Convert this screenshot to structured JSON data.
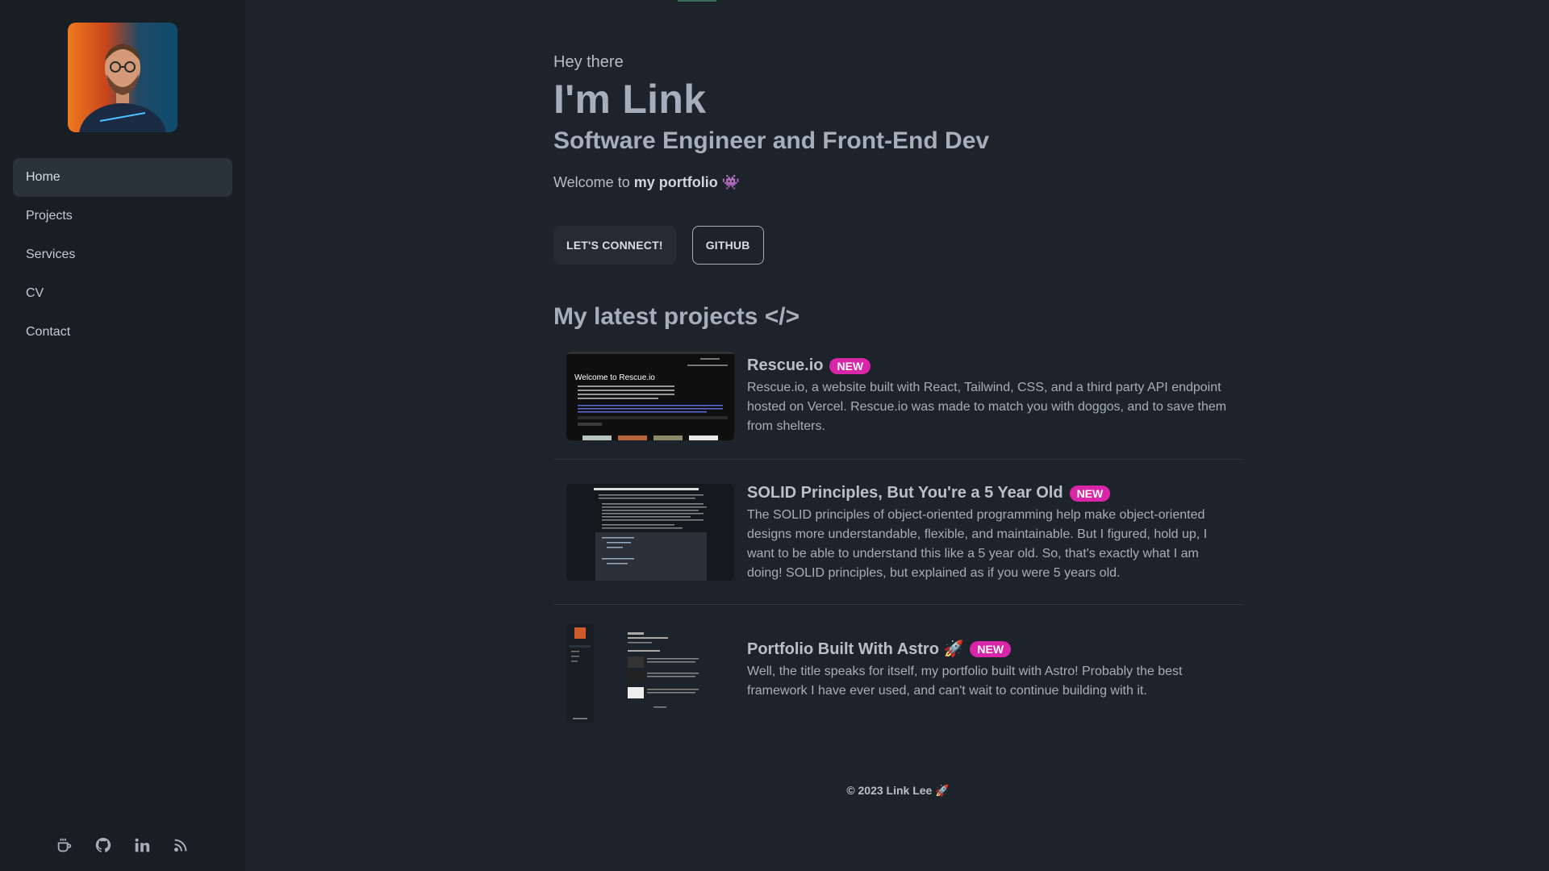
{
  "sidebar": {
    "avatar_alt": "Profile photo",
    "items": [
      {
        "label": "Home",
        "active": true
      },
      {
        "label": "Projects",
        "active": false
      },
      {
        "label": "Services",
        "active": false
      },
      {
        "label": "CV",
        "active": false
      },
      {
        "label": "Contact",
        "active": false
      }
    ],
    "social": [
      "coffee-icon",
      "github-icon",
      "linkedin-icon",
      "rss-icon"
    ]
  },
  "hero": {
    "greeting": "Hey there",
    "name": "I'm Link",
    "role": "Software Engineer and Front-End Dev",
    "welcome_prefix": "Welcome to ",
    "welcome_bold": "my portfolio",
    "welcome_emoji": "👾"
  },
  "buttons": {
    "connect": "LET'S CONNECT!",
    "github": "GITHUB"
  },
  "section_title": "My latest projects </>",
  "projects": [
    {
      "title": "Rescue.io",
      "badge": "NEW",
      "description": "Rescue.io, a website built with React, Tailwind, CSS, and a third party API endpoint hosted on Vercel. Rescue.io was made to match you with doggos, and to save them from shelters."
    },
    {
      "title": "SOLID Principles, But You're a 5 Year Old",
      "badge": "NEW",
      "description": "The SOLID principles of object-oriented programming help make object-oriented designs more understandable, flexible, and maintainable. But I figured, hold up, I want to be able to understand this like a 5 year old. So, that's exactly what I am doing! SOLID principles, but explained as if you were 5 years old."
    },
    {
      "title": "Portfolio Built With Astro 🚀",
      "badge": "NEW",
      "description": "Well, the title speaks for itself, my portfolio built with Astro! Probably the best framework I have ever used, and can't wait to continue building with it."
    }
  ],
  "thumb_text": {
    "rescue_heading": "Welcome to Rescue.io"
  },
  "footer": "© 2023 Link Lee 🚀",
  "colors": {
    "background": "#1d232a",
    "sidebar": "#191e24",
    "badge": "#d926a9",
    "text": "#a6adbb"
  }
}
